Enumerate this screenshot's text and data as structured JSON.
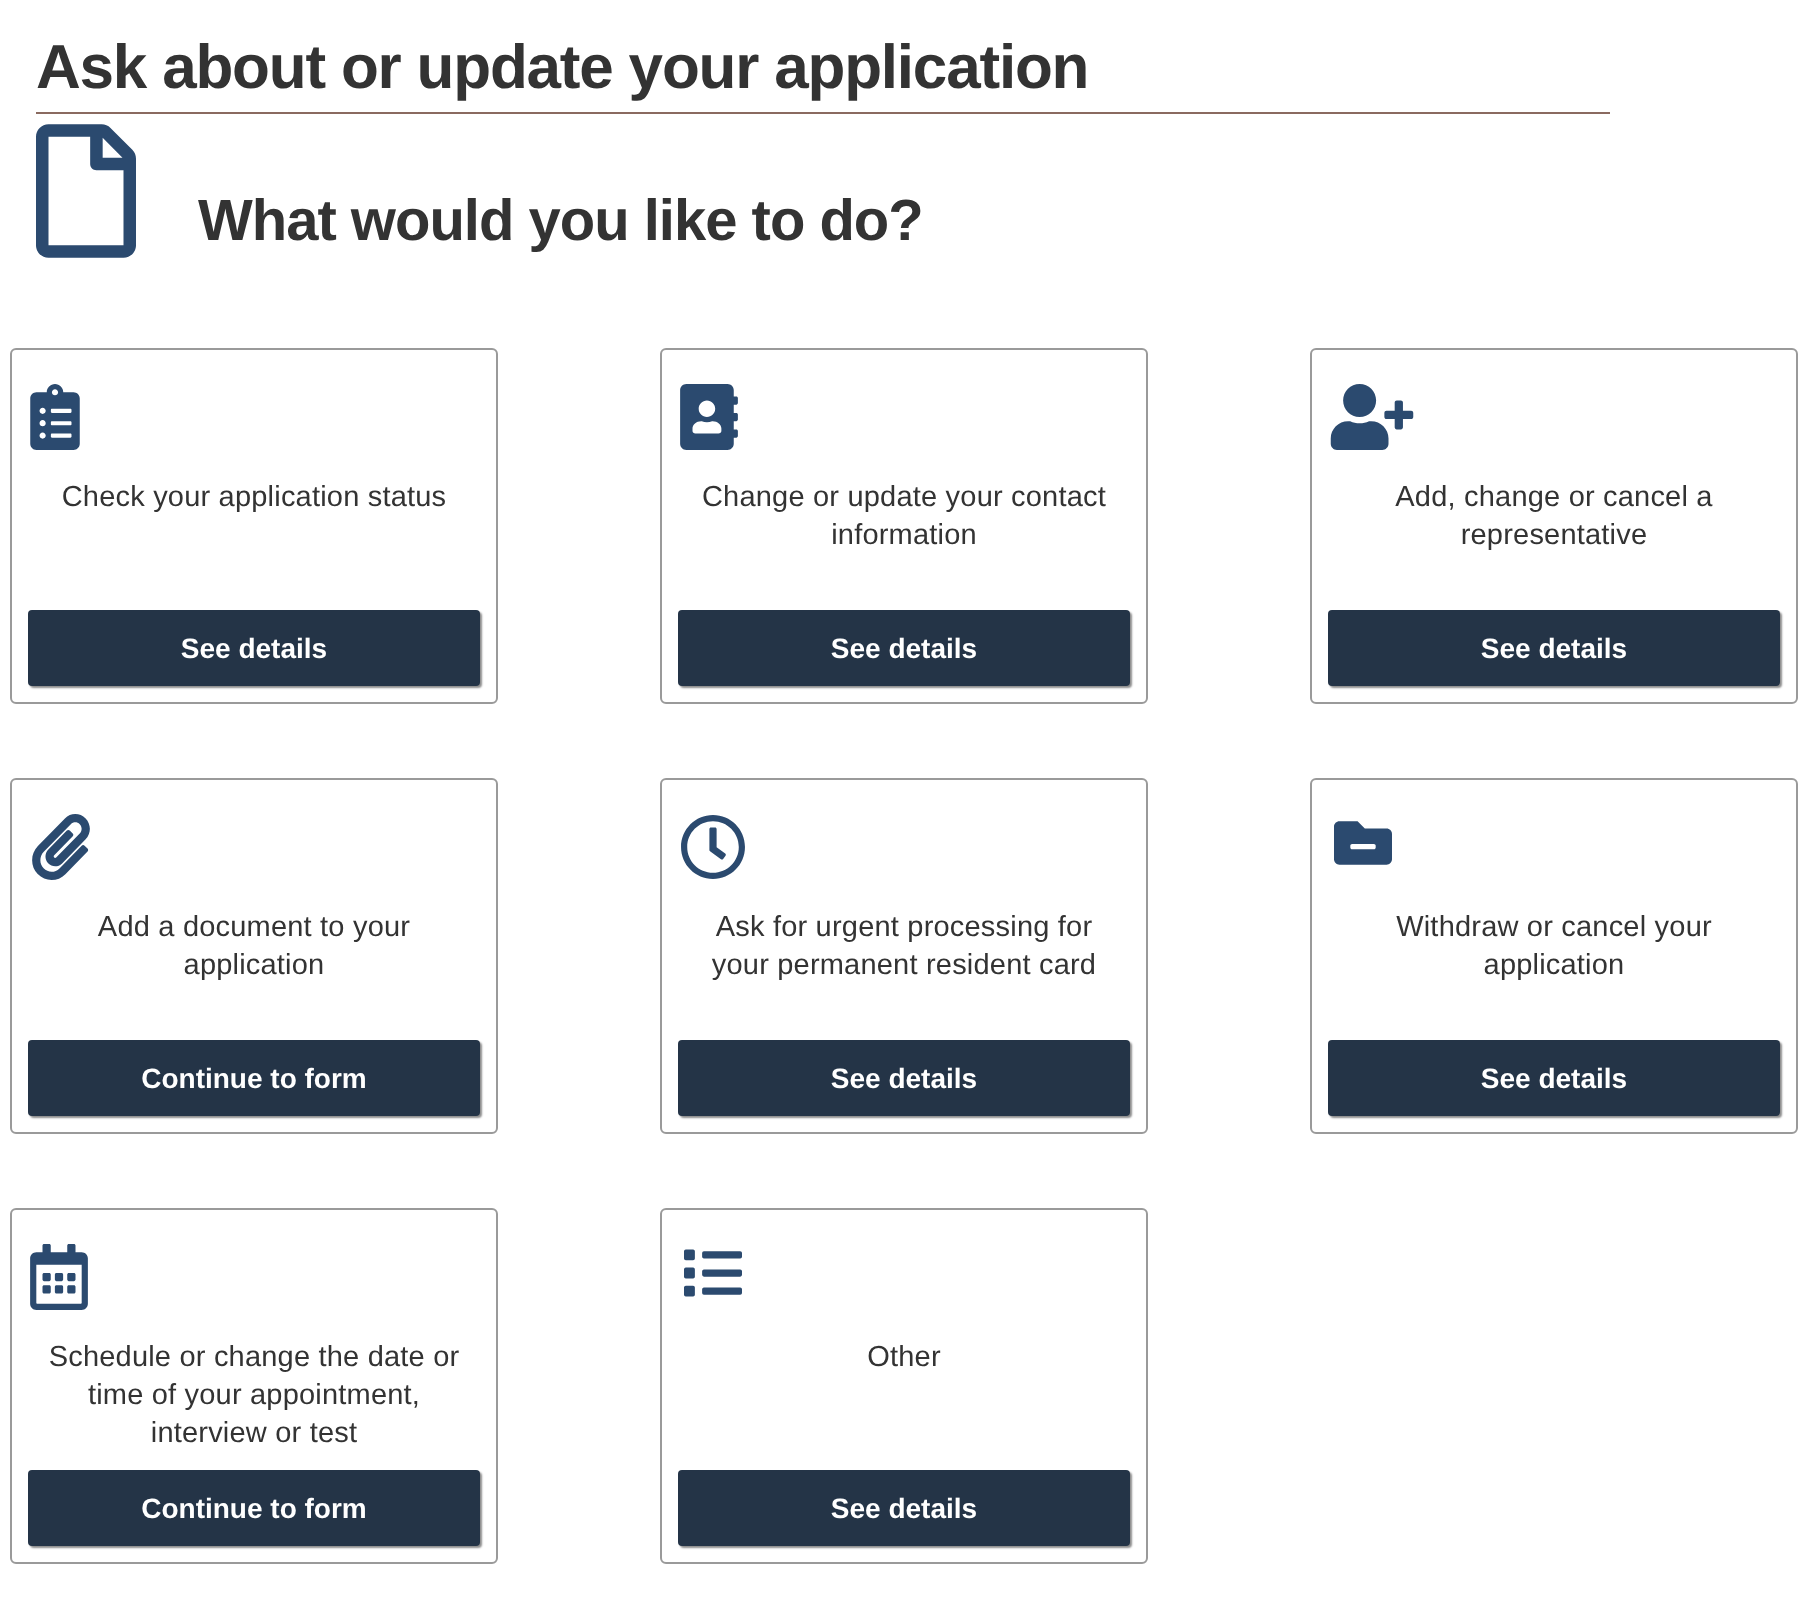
{
  "page": {
    "title": "Ask about or update your application",
    "subtitle": "What would you like to do?"
  },
  "cards": [
    {
      "text": "Check your application status",
      "button": "See details"
    },
    {
      "text": "Change or update your contact information",
      "button": "See details"
    },
    {
      "text": "Add, change or cancel a representative",
      "button": "See details"
    },
    {
      "text": "Add a document to your application",
      "button": "Continue to form"
    },
    {
      "text": "Ask for urgent processing for your permanent resident card",
      "button": "See details"
    },
    {
      "text": "Withdraw or cancel your application",
      "button": "See details"
    },
    {
      "text": "Schedule or change the date or time of your appointment, interview or test",
      "button": "Continue to form"
    },
    {
      "text": "Other",
      "button": "See details"
    }
  ]
}
